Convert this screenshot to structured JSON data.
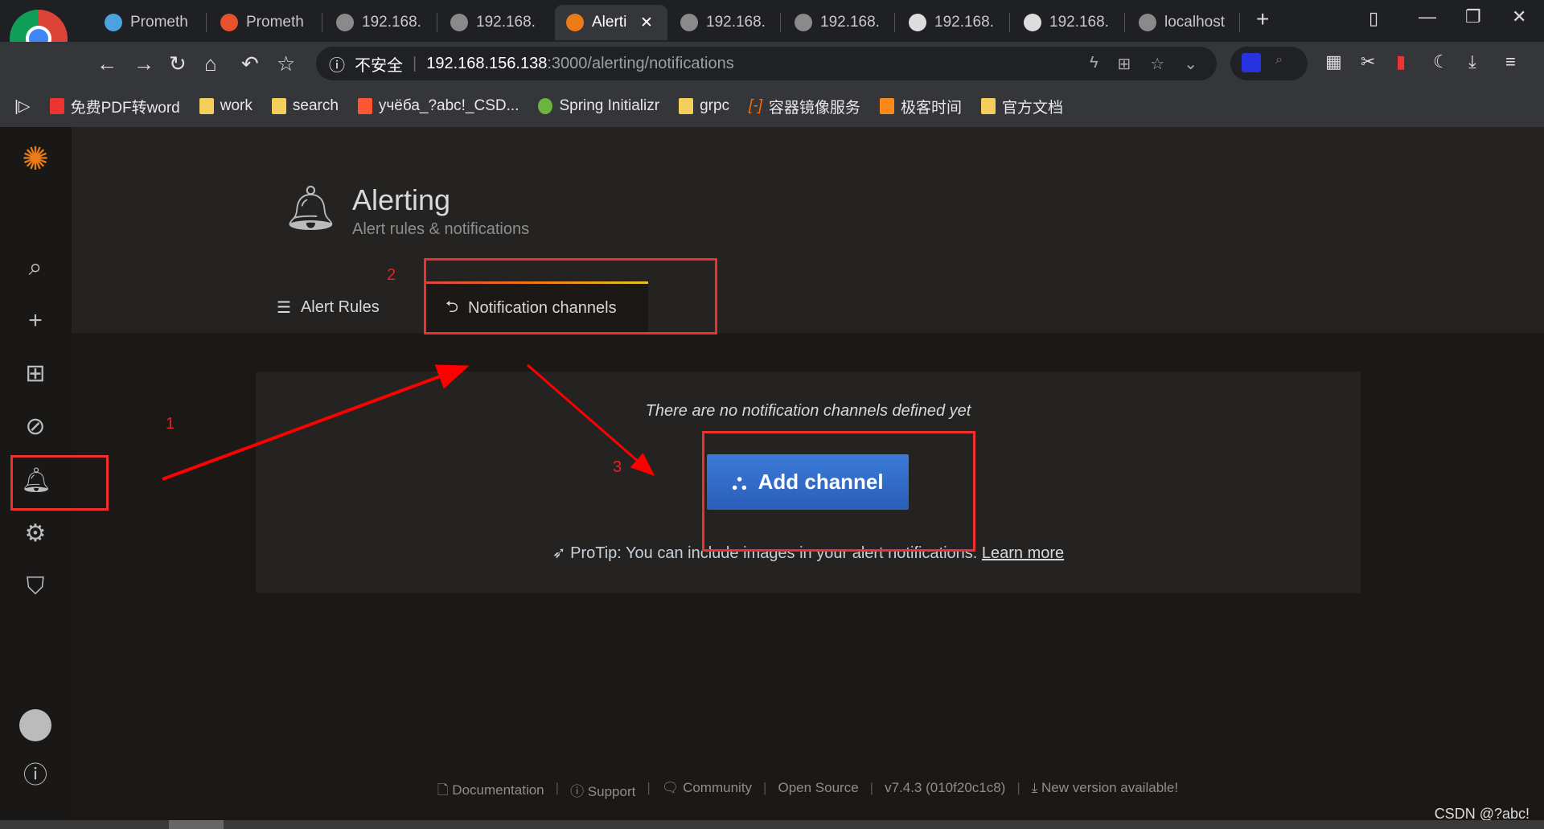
{
  "browser": {
    "tabs": [
      {
        "label": "Prometh"
      },
      {
        "label": "Prometh"
      },
      {
        "label": "192.168."
      },
      {
        "label": "192.168."
      },
      {
        "label": "Alerti",
        "active": true
      },
      {
        "label": "192.168."
      },
      {
        "label": "192.168."
      },
      {
        "label": "192.168."
      },
      {
        "label": "192.168."
      },
      {
        "label": "localhost"
      }
    ],
    "security_label": "不安全",
    "url_host": "192.168.156.138",
    "url_path": ":3000/alerting/notifications",
    "bookmarks": [
      "免费PDF转word",
      "work",
      "search",
      "yчёба_?abc!_CSD...",
      "Spring Initializr",
      "grpc",
      "容器镜像服务",
      "极客时间",
      "官方文档"
    ]
  },
  "page": {
    "title": "Alerting",
    "subtitle": "Alert rules & notifications",
    "tabs": [
      {
        "label": "Alert Rules"
      },
      {
        "label": "Notification channels",
        "active": true
      }
    ],
    "empty_text": "There are no notification channels defined yet",
    "add_button": "Add channel",
    "protip": "ProTip: You can include images in your alert notifications.",
    "learn_more": "Learn more"
  },
  "annotations": {
    "n1": "1",
    "n2": "2",
    "n3": "3",
    "color": "#f03030"
  },
  "footer": {
    "items": [
      "Documentation",
      "Support",
      "Community",
      "Open Source",
      "v7.4.3 (010f20c1c8)",
      "New version available!"
    ]
  },
  "watermark": "CSDN @?abc!",
  "colors": {
    "accent": "#3274d9",
    "tab_active": "#eb7b18"
  }
}
